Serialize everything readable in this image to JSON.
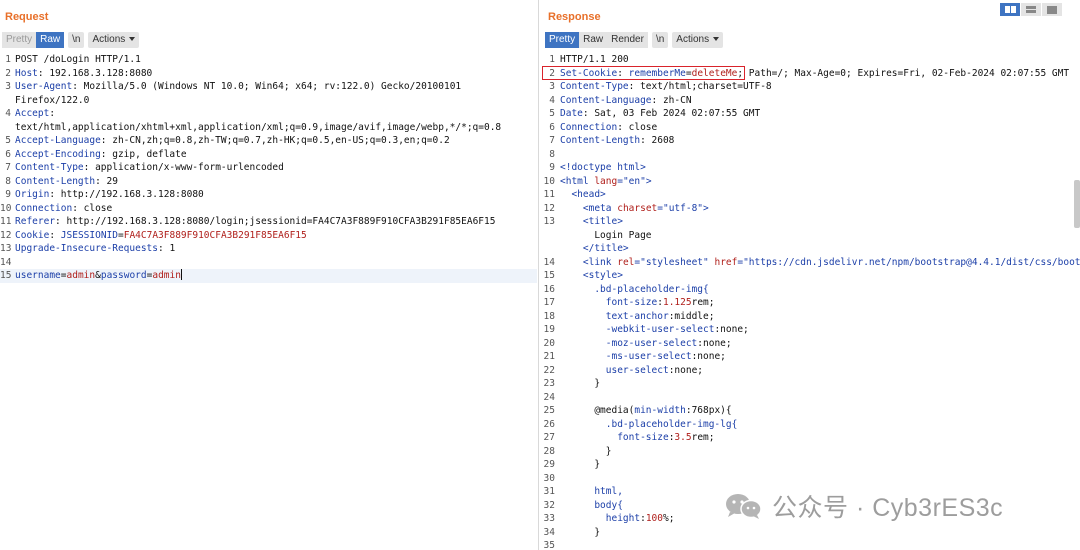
{
  "request": {
    "title": "Request",
    "toolbar": {
      "pretty": "Pretty",
      "raw": "Raw",
      "newline": "\\n",
      "actions": "Actions"
    },
    "lines": [
      {
        "n": "1",
        "segs": [
          {
            "c": "v",
            "t": "POST /doLogin HTTP/1.1"
          }
        ]
      },
      {
        "n": "2",
        "segs": [
          {
            "c": "k",
            "t": "Host"
          },
          {
            "c": "v",
            "t": ": 192.168.3.128:8080"
          }
        ]
      },
      {
        "n": "3",
        "segs": [
          {
            "c": "k",
            "t": "User-Agent"
          },
          {
            "c": "v",
            "t": ": Mozilla/5.0 (Windows NT 10.0; Win64; x64; rv:122.0) Gecko/20100101"
          }
        ]
      },
      {
        "n": "",
        "segs": [
          {
            "c": "v",
            "t": "Firefox/122.0"
          }
        ]
      },
      {
        "n": "4",
        "segs": [
          {
            "c": "k",
            "t": "Accept"
          },
          {
            "c": "v",
            "t": ":"
          }
        ]
      },
      {
        "n": "",
        "segs": [
          {
            "c": "v",
            "t": "text/html,application/xhtml+xml,application/xml;q=0.9,image/avif,image/webp,*/*;q=0.8"
          }
        ]
      },
      {
        "n": "5",
        "segs": [
          {
            "c": "k",
            "t": "Accept-Language"
          },
          {
            "c": "v",
            "t": ": zh-CN,zh;q=0.8,zh-TW;q=0.7,zh-HK;q=0.5,en-US;q=0.3,en;q=0.2"
          }
        ]
      },
      {
        "n": "6",
        "segs": [
          {
            "c": "k",
            "t": "Accept-Encoding"
          },
          {
            "c": "v",
            "t": ": gzip, deflate"
          }
        ]
      },
      {
        "n": "7",
        "segs": [
          {
            "c": "k",
            "t": "Content-Type"
          },
          {
            "c": "v",
            "t": ": application/x-www-form-urlencoded"
          }
        ]
      },
      {
        "n": "8",
        "segs": [
          {
            "c": "k",
            "t": "Content-Length"
          },
          {
            "c": "v",
            "t": ": 29"
          }
        ]
      },
      {
        "n": "9",
        "segs": [
          {
            "c": "k",
            "t": "Origin"
          },
          {
            "c": "v",
            "t": ": http://192.168.3.128:8080"
          }
        ]
      },
      {
        "n": "10",
        "segs": [
          {
            "c": "k",
            "t": "Connection"
          },
          {
            "c": "v",
            "t": ": close"
          }
        ]
      },
      {
        "n": "11",
        "segs": [
          {
            "c": "k",
            "t": "Referer"
          },
          {
            "c": "v",
            "t": ": http://192.168.3.128:8080/login;jsessionid=FA4C7A3F889F910CFA3B291F85EA6F15"
          }
        ]
      },
      {
        "n": "12",
        "segs": [
          {
            "c": "k",
            "t": "Cookie"
          },
          {
            "c": "v",
            "t": ": "
          },
          {
            "c": "pk",
            "t": "JSESSIONID"
          },
          {
            "c": "v",
            "t": "="
          },
          {
            "c": "pv",
            "t": "FA4C7A3F889F910CFA3B291F85EA6F15"
          }
        ]
      },
      {
        "n": "13",
        "segs": [
          {
            "c": "k",
            "t": "Upgrade-Insecure-Requests"
          },
          {
            "c": "v",
            "t": ": 1"
          }
        ]
      },
      {
        "n": "14",
        "segs": []
      },
      {
        "n": "15",
        "current": true,
        "cursor": true,
        "segs": [
          {
            "c": "pk",
            "t": "username"
          },
          {
            "c": "v",
            "t": "="
          },
          {
            "c": "pv",
            "t": "admin"
          },
          {
            "c": "v",
            "t": "&"
          },
          {
            "c": "pk",
            "t": "password"
          },
          {
            "c": "v",
            "t": "="
          },
          {
            "c": "pv",
            "t": "admin"
          }
        ]
      }
    ]
  },
  "response": {
    "title": "Response",
    "toolbar": {
      "pretty": "Pretty",
      "raw": "Raw",
      "render": "Render",
      "newline": "\\n",
      "actions": "Actions"
    },
    "lines": [
      {
        "n": "1",
        "segs": [
          {
            "c": "v",
            "t": "HTTP/1.1 200"
          }
        ]
      },
      {
        "n": "2",
        "segs": [
          {
            "c": "k",
            "t": "Set-Cookie"
          },
          {
            "c": "v",
            "t": ": "
          },
          {
            "c": "pk",
            "t": "rememberMe"
          },
          {
            "c": "v",
            "t": "="
          },
          {
            "c": "pv",
            "t": "deleteMe"
          },
          {
            "c": "v",
            "t": "; Path=/; Max-Age=0; Expires=Fri, 02-Feb-2024 02:07:55 GMT"
          }
        ]
      },
      {
        "n": "3",
        "segs": [
          {
            "c": "k",
            "t": "Content-Type"
          },
          {
            "c": "v",
            "t": ": text/html;charset=UTF-8"
          }
        ]
      },
      {
        "n": "4",
        "segs": [
          {
            "c": "k",
            "t": "Content-Language"
          },
          {
            "c": "v",
            "t": ": zh-CN"
          }
        ]
      },
      {
        "n": "5",
        "segs": [
          {
            "c": "k",
            "t": "Date"
          },
          {
            "c": "v",
            "t": ": Sat, 03 Feb 2024 02:07:55 GMT"
          }
        ]
      },
      {
        "n": "6",
        "segs": [
          {
            "c": "k",
            "t": "Connection"
          },
          {
            "c": "v",
            "t": ": close"
          }
        ]
      },
      {
        "n": "7",
        "segs": [
          {
            "c": "k",
            "t": "Content-Length"
          },
          {
            "c": "v",
            "t": ": 2608"
          }
        ]
      },
      {
        "n": "8",
        "segs": []
      },
      {
        "n": "9",
        "segs": [
          {
            "c": "tag",
            "t": "<!doctype html>"
          }
        ]
      },
      {
        "n": "10",
        "segs": [
          {
            "c": "tag",
            "t": "<html "
          },
          {
            "c": "attr",
            "t": "lang"
          },
          {
            "c": "tag",
            "t": "=\"en\">"
          }
        ]
      },
      {
        "n": "11",
        "segs": [
          {
            "c": "v",
            "t": "  "
          },
          {
            "c": "tag",
            "t": "<head>"
          }
        ]
      },
      {
        "n": "12",
        "segs": [
          {
            "c": "v",
            "t": "    "
          },
          {
            "c": "tag",
            "t": "<meta "
          },
          {
            "c": "attr",
            "t": "charset"
          },
          {
            "c": "tag",
            "t": "=\"utf-8\">"
          }
        ]
      },
      {
        "n": "13",
        "segs": [
          {
            "c": "v",
            "t": "    "
          },
          {
            "c": "tag",
            "t": "<title>"
          }
        ]
      },
      {
        "n": "",
        "segs": [
          {
            "c": "v",
            "t": "      Login Page"
          }
        ]
      },
      {
        "n": "",
        "segs": [
          {
            "c": "v",
            "t": "    "
          },
          {
            "c": "tag",
            "t": "</title>"
          }
        ]
      },
      {
        "n": "14",
        "segs": [
          {
            "c": "v",
            "t": "    "
          },
          {
            "c": "tag",
            "t": "<link "
          },
          {
            "c": "attr",
            "t": "rel"
          },
          {
            "c": "tag",
            "t": "=\"stylesheet\" "
          },
          {
            "c": "attr",
            "t": "href"
          },
          {
            "c": "tag",
            "t": "=\"https://cdn.jsdelivr.net/npm/bootstrap@4.4.1/dist/css/boot"
          }
        ]
      },
      {
        "n": "15",
        "segs": [
          {
            "c": "v",
            "t": "    "
          },
          {
            "c": "tag",
            "t": "<style>"
          }
        ]
      },
      {
        "n": "16",
        "segs": [
          {
            "c": "v",
            "t": "      "
          },
          {
            "c": "css-sel",
            "t": ".bd-placeholder-img{"
          }
        ]
      },
      {
        "n": "17",
        "segs": [
          {
            "c": "v",
            "t": "        "
          },
          {
            "c": "css-sel",
            "t": "font-size"
          },
          {
            "c": "v",
            "t": ":"
          },
          {
            "c": "red",
            "t": "1.125"
          },
          {
            "c": "v",
            "t": "rem;"
          }
        ]
      },
      {
        "n": "18",
        "segs": [
          {
            "c": "v",
            "t": "        "
          },
          {
            "c": "css-sel",
            "t": "text-anchor"
          },
          {
            "c": "v",
            "t": ":middle;"
          }
        ]
      },
      {
        "n": "19",
        "segs": [
          {
            "c": "v",
            "t": "        "
          },
          {
            "c": "css-sel",
            "t": "-webkit-user-select"
          },
          {
            "c": "v",
            "t": ":none;"
          }
        ]
      },
      {
        "n": "20",
        "segs": [
          {
            "c": "v",
            "t": "        "
          },
          {
            "c": "css-sel",
            "t": "-moz-user-select"
          },
          {
            "c": "v",
            "t": ":none;"
          }
        ]
      },
      {
        "n": "21",
        "segs": [
          {
            "c": "v",
            "t": "        "
          },
          {
            "c": "css-sel",
            "t": "-ms-user-select"
          },
          {
            "c": "v",
            "t": ":none;"
          }
        ]
      },
      {
        "n": "22",
        "segs": [
          {
            "c": "v",
            "t": "        "
          },
          {
            "c": "css-sel",
            "t": "user-select"
          },
          {
            "c": "v",
            "t": ":none;"
          }
        ]
      },
      {
        "n": "23",
        "segs": [
          {
            "c": "v",
            "t": "      }"
          }
        ]
      },
      {
        "n": "24",
        "segs": []
      },
      {
        "n": "25",
        "segs": [
          {
            "c": "v",
            "t": "      @media("
          },
          {
            "c": "css-sel",
            "t": "min-width"
          },
          {
            "c": "v",
            "t": ":768px){"
          }
        ]
      },
      {
        "n": "26",
        "segs": [
          {
            "c": "v",
            "t": "        "
          },
          {
            "c": "css-sel",
            "t": ".bd-placeholder-img-lg{"
          }
        ]
      },
      {
        "n": "27",
        "segs": [
          {
            "c": "v",
            "t": "          "
          },
          {
            "c": "css-sel",
            "t": "font-size"
          },
          {
            "c": "v",
            "t": ":"
          },
          {
            "c": "red",
            "t": "3.5"
          },
          {
            "c": "v",
            "t": "rem;"
          }
        ]
      },
      {
        "n": "28",
        "segs": [
          {
            "c": "v",
            "t": "        }"
          }
        ]
      },
      {
        "n": "29",
        "segs": [
          {
            "c": "v",
            "t": "      }"
          }
        ]
      },
      {
        "n": "30",
        "segs": []
      },
      {
        "n": "31",
        "segs": [
          {
            "c": "v",
            "t": "      "
          },
          {
            "c": "css-sel",
            "t": "html,"
          }
        ]
      },
      {
        "n": "32",
        "segs": [
          {
            "c": "v",
            "t": "      "
          },
          {
            "c": "css-sel",
            "t": "body{"
          }
        ]
      },
      {
        "n": "33",
        "segs": [
          {
            "c": "v",
            "t": "        "
          },
          {
            "c": "css-sel",
            "t": "height"
          },
          {
            "c": "v",
            "t": ":"
          },
          {
            "c": "red",
            "t": "100"
          },
          {
            "c": "v",
            "t": "%;"
          }
        ]
      },
      {
        "n": "34",
        "segs": [
          {
            "c": "v",
            "t": "      }"
          }
        ]
      },
      {
        "n": "35",
        "segs": []
      }
    ]
  },
  "watermark": {
    "text": "公众号 · Cyb3rES3c",
    "icon": "wechat-icon"
  },
  "colors": {
    "accent": "#e8702a",
    "active": "#3e74c2",
    "highlight": "#d9232b",
    "key": "#1c3fa8",
    "value": "#b0201c"
  }
}
